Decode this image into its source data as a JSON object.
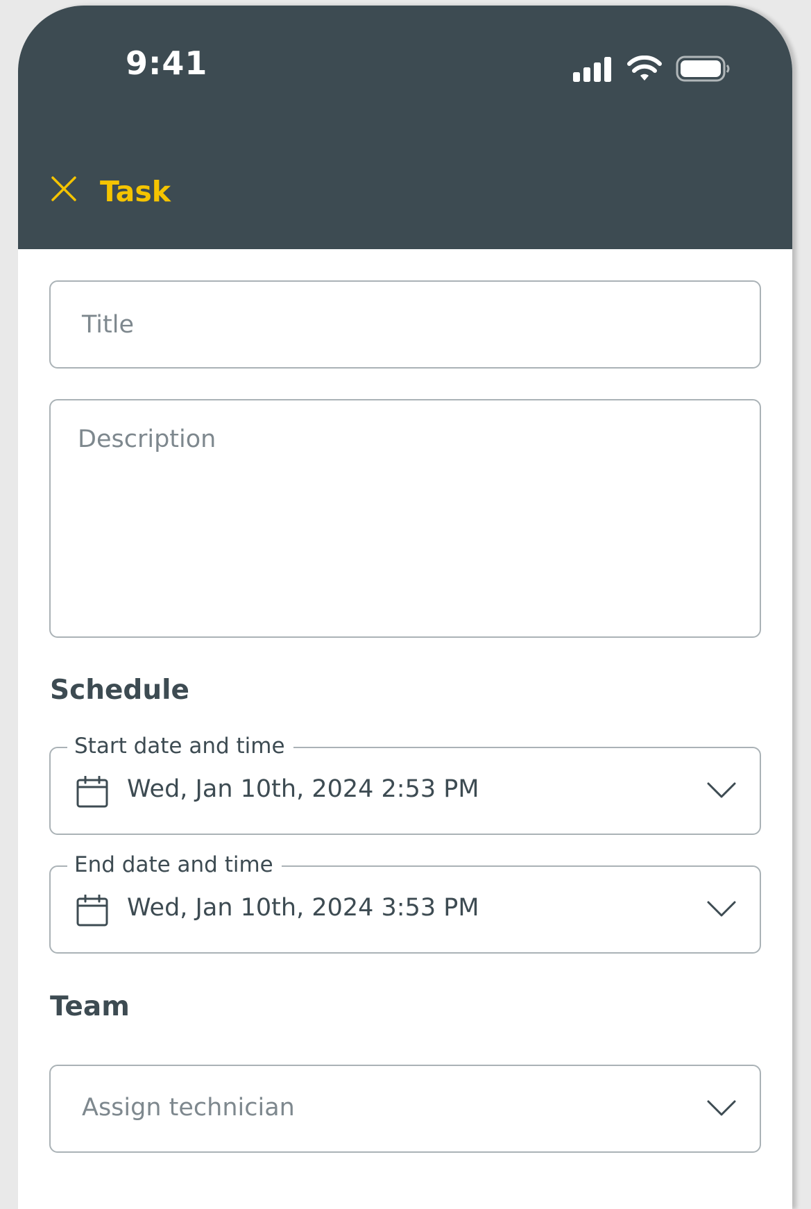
{
  "status_bar": {
    "time": "9:41",
    "icons": [
      "signal-icon",
      "wifi-icon",
      "battery-icon"
    ]
  },
  "header": {
    "title": "Task",
    "close_icon": "close-icon"
  },
  "form": {
    "title_placeholder": "Title",
    "description_placeholder": "Description"
  },
  "schedule": {
    "heading": "Schedule",
    "start": {
      "label": "Start date and time",
      "value": "Wed, Jan 10th, 2024 2:53 PM"
    },
    "end": {
      "label": "End date and time",
      "value": "Wed, Jan 10th, 2024 3:53 PM"
    }
  },
  "team": {
    "heading": "Team",
    "assign_placeholder": "Assign technician"
  },
  "colors": {
    "header_bg": "#3d4b52",
    "accent": "#f5c400",
    "border": "#aab2b6",
    "placeholder": "#7e888e",
    "text": "#3d4b52"
  }
}
